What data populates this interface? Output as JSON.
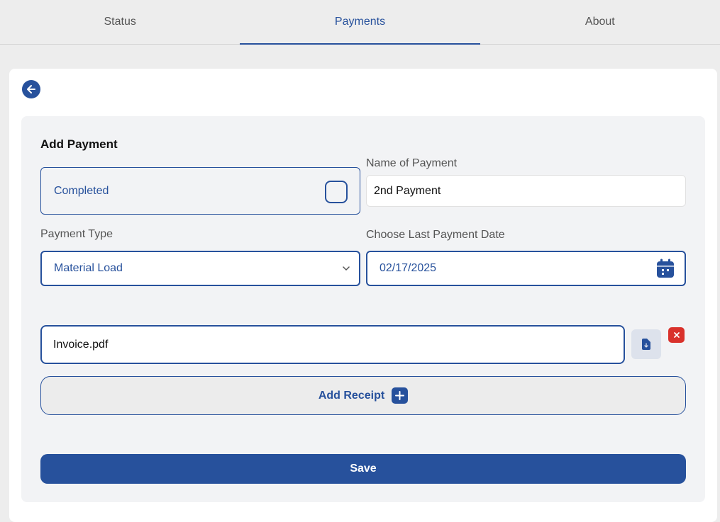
{
  "tabs": [
    {
      "label": "Status",
      "active": false
    },
    {
      "label": "Payments",
      "active": true
    },
    {
      "label": "About",
      "active": false
    }
  ],
  "form": {
    "title": "Add Payment",
    "completed_label": "Completed",
    "completed_checked": false,
    "name_label": "Name of Payment",
    "name_value": "2nd Payment",
    "payment_type_label": "Payment Type",
    "payment_type_value": "Material Load",
    "date_label": "Choose Last Payment Date",
    "date_value": "02/17/2025",
    "file_value": "Invoice.pdf",
    "add_receipt_label": "Add Receipt",
    "save_label": "Save"
  },
  "colors": {
    "primary": "#27519c",
    "danger": "#d9312b",
    "panel_bg": "#f2f3f5",
    "page_bg": "#ededed"
  },
  "icons": {
    "back": "arrow-left-icon",
    "dropdown": "chevron-down-icon",
    "calendar": "calendar-icon",
    "upload": "file-upload-icon",
    "remove": "close-icon",
    "add": "plus-icon"
  }
}
